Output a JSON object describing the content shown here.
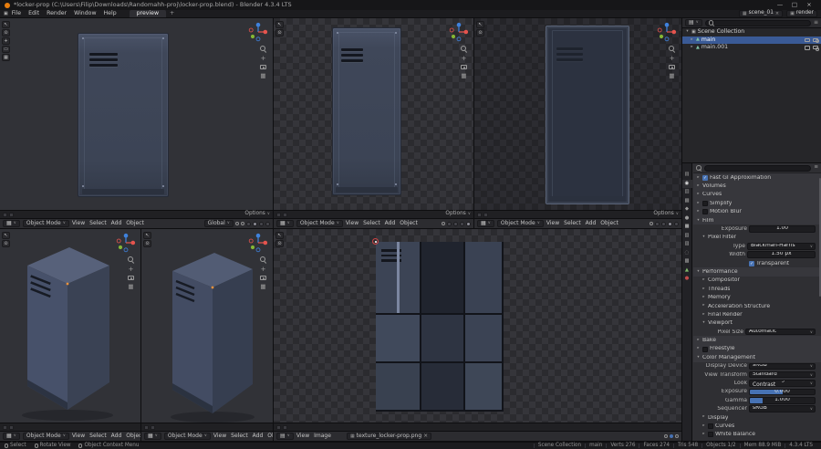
{
  "colors": {
    "accent": "#4772b3",
    "axis-x": "#e5544e",
    "axis-y": "#84b634",
    "axis-z": "#3f82dd"
  },
  "ui": {
    "chevron": "∨",
    "filter": "≡",
    "search_label": ""
  },
  "window": {
    "title": "*locker-prop (C:\\Users\\Filip\\Downloads\\Randomahh-proj\\locker-prop.blend) - Blender 4.3.4 LTS",
    "minimize": "—",
    "maximize": "□",
    "close": "×"
  },
  "topbar": {
    "menus": [
      "File",
      "Edit",
      "Render",
      "Window",
      "Help"
    ],
    "workspace_tab": "preview",
    "add_workspace": "+",
    "scene_icon": "▦",
    "scene_name": "scene_01",
    "scene_unlink": "×",
    "view_layer_icon": "▣",
    "view_layer_name": "render"
  },
  "viewport": {
    "editor_icon": "▦",
    "mode": "Object Mode",
    "menus": [
      "View",
      "Select",
      "Add",
      "Object"
    ],
    "orientation": "Global",
    "options": "Options",
    "toolbar": [
      "↖",
      "⊙",
      "+",
      "▭",
      "▦"
    ],
    "nav_move": "+",
    "nav_grid": "▦"
  },
  "uv_editor": {
    "editor_icon": "▤",
    "menus": [
      "View",
      "Image"
    ],
    "image_icon": "▦",
    "image_name": "texture_locker-prop.png",
    "unlink": "×",
    "toolbar": [
      "↖",
      "⊙"
    ]
  },
  "outliner": {
    "editor_icon": "▤",
    "rows": [
      {
        "arrow": "▾",
        "label": "Scene Collection"
      },
      {
        "arrow": "▸",
        "label": "main"
      },
      {
        "arrow": "▸",
        "label": "main.001"
      }
    ]
  },
  "properties": {
    "tabs": [
      {
        "name": "tool",
        "glyph": "▤"
      },
      {
        "name": "render",
        "glyph": "◉"
      },
      {
        "name": "output",
        "glyph": "▥"
      },
      {
        "name": "view-layer",
        "glyph": "▦"
      },
      {
        "name": "scene",
        "glyph": "◆"
      },
      {
        "name": "world",
        "glyph": "●"
      },
      {
        "name": "object",
        "glyph": "■"
      },
      {
        "name": "modifiers",
        "glyph": "▧"
      },
      {
        "name": "particles",
        "glyph": "▨"
      },
      {
        "name": "physics",
        "glyph": "◌"
      },
      {
        "name": "constraints",
        "glyph": "▩"
      },
      {
        "name": "data",
        "glyph": "▲"
      },
      {
        "name": "material",
        "glyph": "●"
      }
    ],
    "rows": [
      {
        "arrow": "▸",
        "check": "✓",
        "label": "Fast GI Approximation"
      },
      {
        "arrow": "▸",
        "label": "Volumes"
      },
      {
        "arrow": "▸",
        "label": "Curves"
      },
      {
        "arrow": "▸",
        "check": "",
        "label": "Simplify"
      },
      {
        "arrow": "▸",
        "check": "",
        "label": "Motion Blur"
      },
      {
        "arrow": "▾",
        "label": "Film"
      },
      {
        "label": "Exposure",
        "value": "1.00"
      },
      {
        "arrow": "▾",
        "label": "Pixel Filter"
      },
      {
        "label": "Type",
        "value": "Blackman-Harris"
      },
      {
        "label": "Width",
        "value": "1.50 px"
      },
      {
        "check": "✓",
        "label": "Transparent"
      },
      {
        "arrow": "▾",
        "label": "Performance"
      },
      {
        "arrow": "▸",
        "label": "Compositor"
      },
      {
        "arrow": "▸",
        "label": "Threads"
      },
      {
        "arrow": "▸",
        "label": "Memory"
      },
      {
        "arrow": "▸",
        "label": "Acceleration Structure"
      },
      {
        "arrow": "▸",
        "label": "Final Render"
      },
      {
        "arrow": "▾",
        "label": "Viewport"
      },
      {
        "label": "Pixel Size",
        "value": "Automatic"
      },
      {
        "arrow": "▸",
        "label": "Bake"
      },
      {
        "arrow": "▸",
        "check": "",
        "label": "Freestyle"
      },
      {
        "arrow": "▾",
        "label": "Color Management"
      },
      {
        "label": "Display Device",
        "value": "sRGB"
      },
      {
        "label": "View Transform",
        "value": "Standard"
      },
      {
        "label": "Look",
        "value": "Medium High Contrast"
      },
      {
        "label": "Exposure",
        "value": "0.000",
        "fill_style": "width:50%"
      },
      {
        "label": "Gamma",
        "value": "1.000",
        "fill_style": "width:20%"
      },
      {
        "label": "Sequencer",
        "value": "sRGB"
      },
      {
        "arrow": "▸",
        "label": "Display"
      },
      {
        "arrow": "▸",
        "check": "",
        "label": "Curves"
      },
      {
        "arrow": "▸",
        "check": "",
        "label": "White Balance"
      }
    ]
  },
  "status": {
    "hints": [
      "Select",
      "Rotate View",
      "Object Context Menu"
    ],
    "stats": [
      "Scene Collection",
      "main",
      "Verts 276",
      "Faces 274",
      "Tris 548",
      "Objects 1/2",
      "Mem 88.9 MiB",
      "4.3.4 LTS"
    ]
  }
}
